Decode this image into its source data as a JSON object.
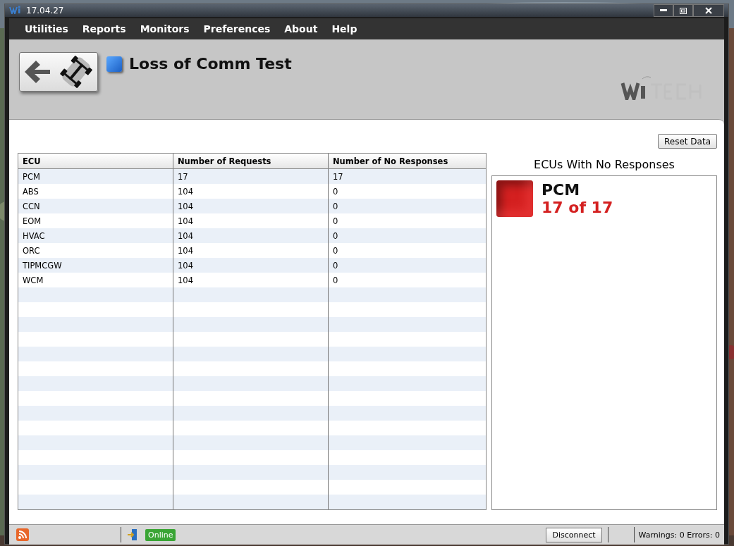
{
  "window": {
    "title": "17.04.27"
  },
  "menu": [
    "Utilities",
    "Reports",
    "Monitors",
    "Preferences",
    "About",
    "Help"
  ],
  "page": {
    "title": "Loss of Comm Test"
  },
  "reset_button": "Reset Data",
  "table": {
    "columns": [
      "ECU",
      "Number of Requests",
      "Number of No Responses"
    ],
    "rows": [
      [
        "PCM",
        "17",
        "17"
      ],
      [
        "ABS",
        "104",
        "0"
      ],
      [
        "CCN",
        "104",
        "0"
      ],
      [
        "EOM",
        "104",
        "0"
      ],
      [
        "HVAC",
        "104",
        "0"
      ],
      [
        "ORC",
        "104",
        "0"
      ],
      [
        "TIPMCGW",
        "104",
        "0"
      ],
      [
        "WCM",
        "104",
        "0"
      ]
    ]
  },
  "no_response_panel": {
    "title": "ECUs With No Responses",
    "items": [
      {
        "name": "PCM",
        "count": "17 of 17",
        "color": "#d42020"
      }
    ]
  },
  "status_bar": {
    "connection": "Online",
    "disconnect_button": "Disconnect",
    "summary": "Warnings: 0 Errors: 0"
  }
}
